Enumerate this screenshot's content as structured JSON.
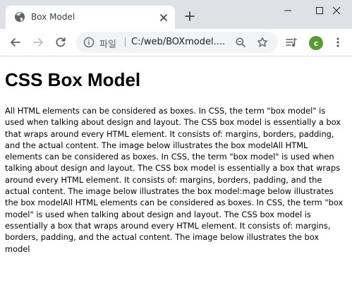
{
  "tab": {
    "title": "Box Model",
    "favicon": "globe-icon",
    "close": "close-icon"
  },
  "toolbar": {
    "back": "back-arrow-icon",
    "forward": "forward-arrow-icon",
    "reload": "reload-icon",
    "address": {
      "scheme_label": "파일",
      "url": "C:/web/BOXmodel....",
      "info": "info-icon",
      "zoom": "zoom-icon",
      "bookmark": "star-icon"
    },
    "media": "media-control-icon",
    "profile_initial": "c",
    "menu": "more-vertical-icon"
  },
  "window_controls": [
    "minimize-icon",
    "maximize-icon",
    "close-icon"
  ],
  "colors": {
    "tab_strip": "#dee1e6",
    "omnibox": "#f1f3f4",
    "avatar": "#5a9a32",
    "icon": "#5f6368"
  },
  "page": {
    "heading": "CSS Box Model",
    "paragraph": "All HTML elements can be considered as boxes. In CSS, the term \"box model\" is used when talking about design and layout. The CSS box model is essentially a box that wraps around every HTML element. It consists of: margins, borders, padding, and the actual content. The image below illustrates the box modelAll HTML elements can be considered as boxes. In CSS, the term \"box model\" is used when talking about design and layout. The CSS box model is essentially a box that wraps around every HTML element. It consists of: margins, borders, padding, and the actual content. The image below illustrates the box model:mage below illustrates the box modelAll HTML elements can be considered as boxes. In CSS, the term \"box model\" is used when talking about design and layout. The CSS box model is essentially a box that wraps around every HTML element. It consists of: margins, borders, padding, and the actual content. The image below illustrates the box model"
  }
}
